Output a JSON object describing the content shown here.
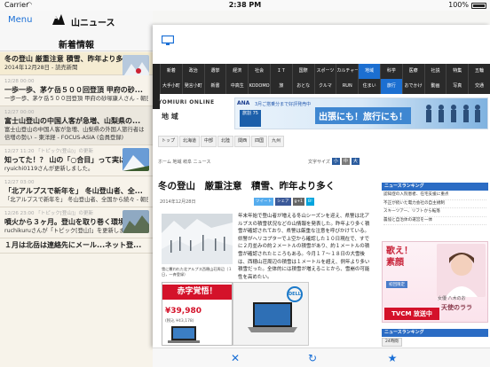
{
  "status": {
    "carrier": "Carrier",
    "time": "2:38 PM",
    "battery": "100%"
  },
  "nav": {
    "menu_label": "Menu",
    "logo_text": "山ニュース",
    "section_title": "新着情報"
  },
  "feed": [
    {
      "title": "冬の登山 厳重注意 積雪、昨年より多く",
      "sub": "2014年12月28日 - 読売新聞",
      "meta": "",
      "highlight": true,
      "thumb": true
    },
    {
      "title": "一歩一歩、茅ケ岳５００回登頂 甲府の砂...",
      "sub": "一歩一歩、茅ケ岳５００回登頂 甲府の砂塚康人さん - 朝日新聞",
      "meta": "",
      "highlight": false,
      "thumb": false
    },
    {
      "title": "富士山登山の中国人客が急増、山梨県の...",
      "sub": "富士山登山の中国人客が急増、山梨県の外国人旅行者は倍増の勢い – 東洋経 - FOCUS-ASIA (会員登録)",
      "meta": "",
      "highlight": false,
      "thumb": false
    },
    {
      "title": "知ってた！？ 山の「○合目」って実は高...",
      "sub": "ryuichi0119さんが更新しました。",
      "meta": "",
      "highlight": false,
      "thumb": true
    },
    {
      "title": "「北アルプスで新年を」 冬山登山者、全...",
      "sub": "「北アルプスで新年を」 冬山登山者、全国から続々 - 朝日新聞",
      "meta": "",
      "highlight": false,
      "thumb": false
    },
    {
      "title": "噴火から３ヶ月。登山を取り巻く環境...",
      "sub": "ruchikuruさんが「トピック[登山]」を更新しました。",
      "meta": "",
      "highlight": false,
      "thumb": true
    },
    {
      "title": "１月は北岳は連絡先にメール...ネット登...",
      "sub": "",
      "meta": "",
      "highlight": false,
      "thumb": false
    }
  ],
  "feed_meta": [
    "",
    "12/28 00:00",
    "12/27 00:00",
    "12/27 11:20 「トピック(登山)」の更新",
    "12/27 03:00",
    "12/26 23:00 「トピック[登山]」の更新",
    ""
  ],
  "web": {
    "nav1": [
      "新着",
      "政治",
      "選挙",
      "経済",
      "社会",
      "ＩＴ",
      "国際",
      "スポーツ",
      "カルチャー",
      "地域",
      "科学",
      "医療",
      "社説",
      "特集",
      "五輪"
    ],
    "nav2": [
      "大手小町",
      "発言小町",
      "新書",
      "中高生",
      "KODOMO",
      "旅",
      "おとな",
      "クルマ",
      "RUN",
      "住まい",
      "旅行",
      "おでかけ",
      "動画",
      "写真",
      "交通"
    ],
    "brand": "YOMIURI ONLINE",
    "region": "地 域",
    "banner": {
      "ana": "ANA",
      "ana_sub": "3月ご搭乗分まで好評発売中",
      "tabi": "旅割 75",
      "copy": "出張にも！旅行にも！"
    },
    "subtabs": [
      "トップ",
      "北海道",
      "中部",
      "北陸",
      "関西",
      "四国",
      "九州"
    ],
    "crumb": "ホーム  地域  岐阜  ニュース",
    "fontsize_label": "文字サイズ",
    "fontsizes": [
      "小",
      "中",
      "大"
    ],
    "headline": "冬の登山　厳重注意　積雪、昨年より多く",
    "pubdate": "2014年12月28日",
    "share": [
      "ツイート",
      "シェア",
      "g+1",
      "B!"
    ],
    "caption": "雪に覆われた北アルプス西穂山荘周辺（１日，一斉登録）",
    "body": "年末年始で登山者が増える冬山シーズンを迎え、県警は北アルプスの積雪状況などの山情報を発表した。昨年より多く積雪が確認されており、県警は厳重な注意を呼びかけている。県警がヘリコプターで上空から確認した１０日現在で、すでに２月並みの約２メートルの積雪があり、約１メートルの積雪が確認されたところもある。今月１７～１８日の大雪後は、西穂山荘周辺の積雪は１メートルを超え、例年より多い積雪だった。全体的には積雪が増えることから、雪崩の可能性を高めたい。",
    "ad_red": {
      "title": "赤字覚悟！",
      "price": "¥39,980",
      "tax": "(税込 ¥43,178)"
    },
    "ad_dell": {
      "brand": "DELL"
    },
    "side_head": "ニュースランキング",
    "side_list": [
      "認知症の入院患者、在宅支援に重点",
      "不正が続いた電力会社の自主規制",
      "スキーツアー、リフトから転落",
      "農協と自治体の運営を一体"
    ],
    "side_ad": {
      "title": "歌え！\n素顔",
      "pill": "初回限定",
      "name": "女優 八木のお",
      "brand": "天使のララ",
      "tvcm": "TVCM 放送中"
    },
    "rank_head": "ニュースランキング",
    "rank_tabs": [
      "24時間"
    ]
  },
  "toolbar": {
    "close": "✕",
    "reload": "↻",
    "star": "★"
  }
}
